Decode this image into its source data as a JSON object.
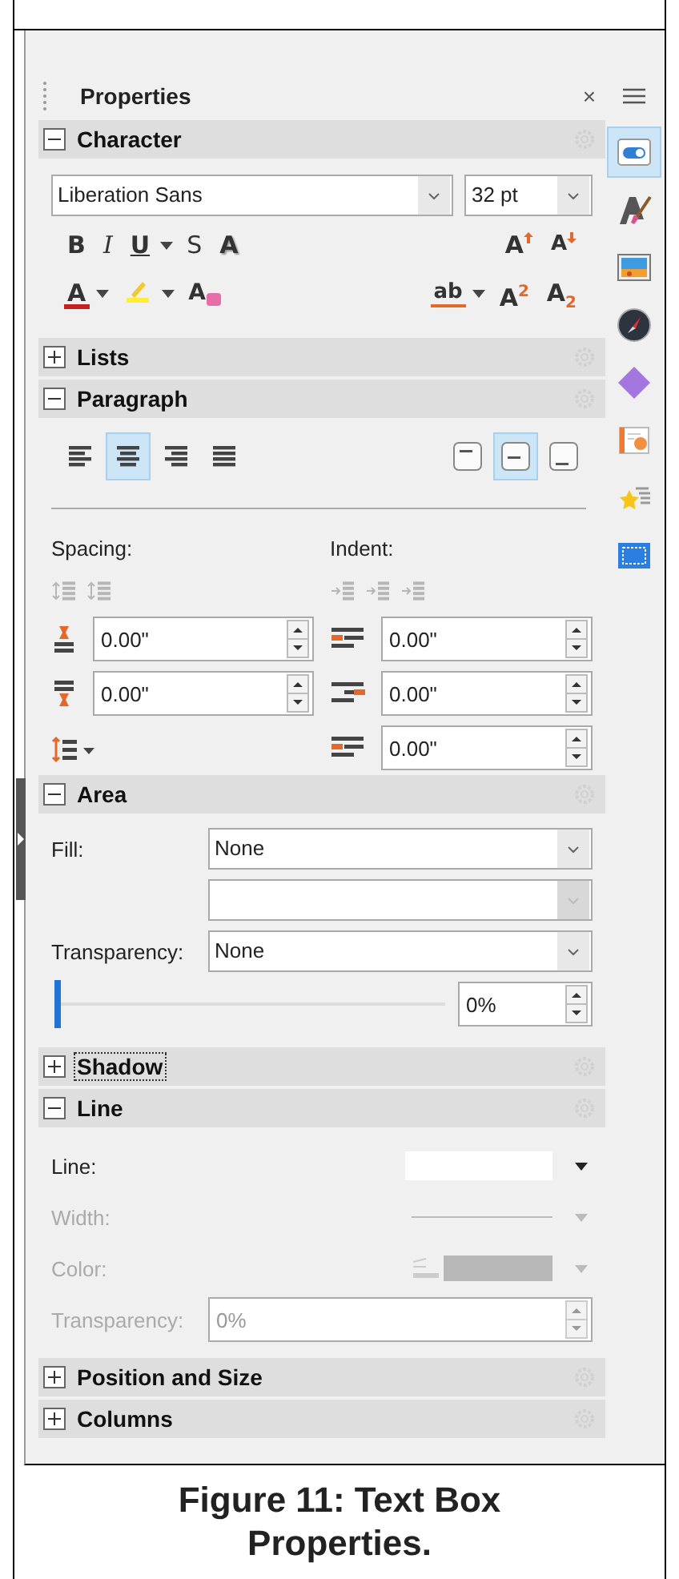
{
  "sidebar": {
    "title": "Properties",
    "close": "×"
  },
  "tabs": [
    {
      "kind": "properties",
      "selected": true
    },
    {
      "kind": "styles",
      "selected": false
    },
    {
      "kind": "gallery",
      "selected": false
    },
    {
      "kind": "navigator",
      "selected": false
    },
    {
      "kind": "shapes",
      "selected": false
    },
    {
      "kind": "transition",
      "selected": false
    },
    {
      "kind": "animation",
      "selected": false
    },
    {
      "kind": "master",
      "selected": false
    }
  ],
  "sections": [
    {
      "kind": "character",
      "title": "Character",
      "expanded": true,
      "focused": false,
      "font": "Liberation Sans",
      "size": "32 pt",
      "tool_rows": [
        {
          "left": [
            {
              "kind": "bold",
              "text": "B"
            },
            {
              "kind": "italic",
              "text": "I"
            },
            {
              "kind": "underline",
              "text": "U",
              "dropdown": true
            },
            {
              "kind": "strike",
              "text": "S"
            },
            {
              "kind": "shadow",
              "text": "A"
            }
          ],
          "right": [
            {
              "kind": "grow",
              "text": "A"
            },
            {
              "kind": "shrink",
              "text": "A"
            }
          ]
        },
        {
          "left": [
            {
              "kind": "font-color",
              "text": "A",
              "dropdown": true
            },
            {
              "kind": "highlight",
              "dropdown": true
            },
            {
              "kind": "clear",
              "text": "A"
            }
          ],
          "right": [
            {
              "kind": "spacing",
              "text": "ab",
              "dropdown": true
            },
            {
              "kind": "super",
              "text": "A$^{2}$"
            },
            {
              "kind": "sub",
              "text": "A$_{2}$"
            }
          ]
        }
      ]
    },
    {
      "kind": "lists",
      "title": "Lists",
      "expanded": false,
      "focused": false
    },
    {
      "kind": "paragraph",
      "title": "Paragraph",
      "expanded": true,
      "focused": false,
      "align": [
        {
          "kind": "left",
          "selected": false
        },
        {
          "kind": "center",
          "selected": true
        },
        {
          "kind": "right",
          "selected": false
        },
        {
          "kind": "justify",
          "selected": false
        }
      ],
      "valign": [
        {
          "kind": "top",
          "selected": false
        },
        {
          "kind": "middle",
          "selected": true
        },
        {
          "kind": "bottom",
          "selected": false
        }
      ],
      "spacing_label": "Spacing:",
      "indent_label": "Indent:",
      "spacing_tools": [
        {
          "disabled": true
        },
        {
          "disabled": true
        }
      ],
      "indent_tools": [
        {
          "disabled": true
        },
        {
          "disabled": true
        },
        {
          "disabled": true
        }
      ],
      "spacing_fields": [
        {
          "value": "0.00\""
        },
        {
          "value": "0.00\""
        }
      ],
      "indent_fields": [
        {
          "value": "0.00\""
        },
        {
          "value": "0.00\""
        },
        {
          "value": "0.00\""
        }
      ]
    },
    {
      "kind": "area",
      "title": "Area",
      "expanded": true,
      "focused": false,
      "fields": [
        {
          "label": "Fill:",
          "value": "None",
          "disabled": false
        },
        {
          "disabled": true
        },
        {
          "label": "Transparency:",
          "value": "None",
          "disabled": false
        }
      ],
      "slider": {
        "level": 0,
        "value": "0%"
      }
    },
    {
      "kind": "shadow",
      "title": "Shadow",
      "expanded": false,
      "focused": true
    },
    {
      "kind": "line",
      "title": "Line",
      "expanded": true,
      "focused": false,
      "rows": [
        {
          "kind": "swatch",
          "label": "Line:",
          "disabled": false
        },
        {
          "kind": "width",
          "label": "Width:",
          "disabled": true
        },
        {
          "kind": "color",
          "label": "Color:",
          "disabled": true
        },
        {
          "kind": "field",
          "label": "Transparency:",
          "value": "0%",
          "disabled": true
        }
      ]
    },
    {
      "kind": "position",
      "title": "Position and Size",
      "expanded": false,
      "focused": false
    },
    {
      "kind": "columns",
      "title": "Columns",
      "expanded": false,
      "focused": false
    }
  ],
  "caption": "Figure 11: Text Box Properties."
}
